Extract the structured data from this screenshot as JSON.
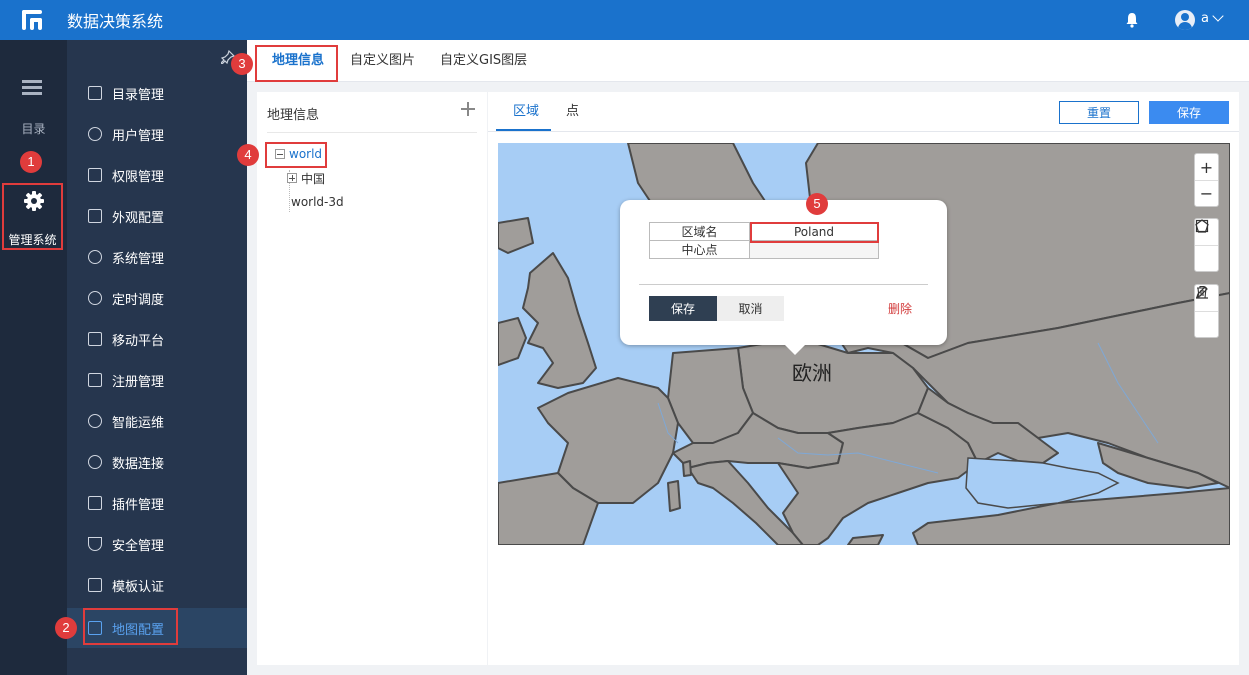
{
  "app": {
    "title": "数据决策系统"
  },
  "user": {
    "name": "a"
  },
  "rail": {
    "dir_label": "目录",
    "admin_label": "管理系统"
  },
  "menu": {
    "items": [
      {
        "label": "目录管理",
        "icon": "list-icon"
      },
      {
        "label": "用户管理",
        "icon": "user-icon"
      },
      {
        "label": "权限管理",
        "icon": "lock-icon"
      },
      {
        "label": "外观配置",
        "icon": "brush-icon"
      },
      {
        "label": "系统管理",
        "icon": "gear-icon"
      },
      {
        "label": "定时调度",
        "icon": "timer-icon"
      },
      {
        "label": "移动平台",
        "icon": "mobile-icon"
      },
      {
        "label": "注册管理",
        "icon": "register-icon"
      },
      {
        "label": "智能运维",
        "icon": "network-icon"
      },
      {
        "label": "数据连接",
        "icon": "link-icon"
      },
      {
        "label": "插件管理",
        "icon": "plugin-icon"
      },
      {
        "label": "安全管理",
        "icon": "shield-icon"
      },
      {
        "label": "模板认证",
        "icon": "template-icon"
      },
      {
        "label": "地图配置",
        "icon": "map-icon",
        "active": true
      }
    ]
  },
  "tabs": [
    "地理信息",
    "自定义图片",
    "自定义GIS图层"
  ],
  "left_panel": {
    "title": "地理信息",
    "tree": [
      {
        "label": "world",
        "expanded": true
      },
      {
        "label": "中国",
        "expanded": false
      },
      {
        "label": "world-3d"
      }
    ]
  },
  "right_panel": {
    "sub_tabs": [
      "区域",
      "点"
    ],
    "reset_label": "重置",
    "save_label": "保存"
  },
  "map": {
    "continent_label": "欧洲",
    "colors": {
      "land": "#a09d9a",
      "water": "#a7cdf5",
      "border": "#4a4a4a"
    }
  },
  "popup": {
    "rows": [
      {
        "key": "区域名",
        "value": "Poland"
      },
      {
        "key": "中心点",
        "value": ""
      }
    ],
    "save_label": "保存",
    "cancel_label": "取消",
    "delete_label": "删除"
  },
  "badges": [
    "1",
    "2",
    "3",
    "4",
    "5"
  ],
  "colors": {
    "accent": "#1a72cc",
    "highlight": "#e03c3c"
  }
}
